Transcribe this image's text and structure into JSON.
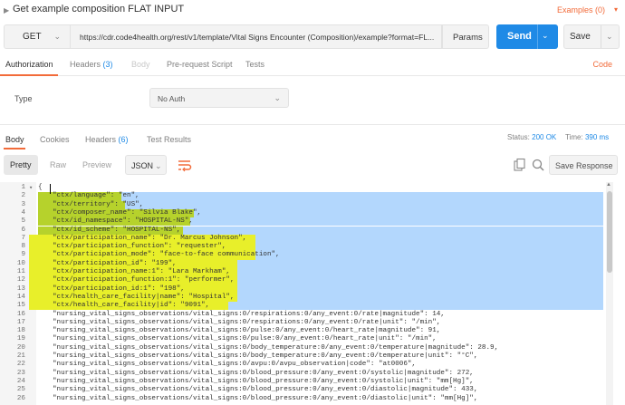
{
  "header": {
    "title": "Get example composition FLAT INPUT",
    "examples_label": "Examples (0)"
  },
  "request": {
    "method": "GET",
    "url": "https://cdr.code4health.org/rest/v1/template/Vital Signs Encounter (Composition)/example?format=FL...",
    "params_label": "Params",
    "send_label": "Send",
    "save_label": "Save"
  },
  "request_tabs": [
    {
      "label": "Authorization",
      "count": ""
    },
    {
      "label": "Headers",
      "count": "(3)"
    },
    {
      "label": "Body",
      "count": ""
    },
    {
      "label": "Pre-request Script",
      "count": ""
    },
    {
      "label": "Tests",
      "count": ""
    }
  ],
  "code_label": "Code",
  "auth": {
    "type_label": "Type",
    "type_value": "No Auth"
  },
  "response_tabs": [
    {
      "label": "Body",
      "count": ""
    },
    {
      "label": "Cookies",
      "count": ""
    },
    {
      "label": "Headers",
      "count": "(6)"
    },
    {
      "label": "Test Results",
      "count": ""
    }
  ],
  "response_meta": {
    "status_label": "Status:",
    "status_value": "200 OK",
    "time_label": "Time:",
    "time_value": "390 ms"
  },
  "view_modes": [
    "Pretty",
    "Raw",
    "Preview"
  ],
  "format_value": "JSON",
  "save_response_label": "Save Response",
  "colors": {
    "accent": "#f26b3a",
    "send_blue": "#1f8ae6",
    "selection": "#b3d7fd",
    "highlight_yellow": "#e8ef2a",
    "highlight_green": "#b6d22c"
  },
  "code_lines": [
    {
      "n": "1",
      "fold": "▾",
      "text": "{"
    },
    {
      "n": "2",
      "fold": "",
      "text": "\"ctx/language\": \"en\","
    },
    {
      "n": "3",
      "fold": "",
      "text": "\"ctx/territory\": \"US\","
    },
    {
      "n": "4",
      "fold": "",
      "text": "\"ctx/composer_name\": \"Silvia Blake\","
    },
    {
      "n": "5",
      "fold": "",
      "text": "\"ctx/id_namespace\": \"HOSPITAL-NS\","
    },
    {
      "n": "6",
      "fold": "",
      "text": "\"ctx/id_scheme\": \"HOSPITAL-NS\","
    },
    {
      "n": "7",
      "fold": "",
      "text": "\"ctx/participation_name\": \"Dr. Marcus Johnson\","
    },
    {
      "n": "8",
      "fold": "",
      "text": "\"ctx/participation_function\": \"requester\","
    },
    {
      "n": "9",
      "fold": "",
      "text": "\"ctx/participation_mode\": \"face-to-face communication\","
    },
    {
      "n": "10",
      "fold": "",
      "text": "\"ctx/participation_id\": \"199\","
    },
    {
      "n": "11",
      "fold": "",
      "text": "\"ctx/participation_name:1\": \"Lara Markham\","
    },
    {
      "n": "12",
      "fold": "",
      "text": "\"ctx/participation_function:1\": \"performer\","
    },
    {
      "n": "13",
      "fold": "",
      "text": "\"ctx/participation_id:1\": \"198\","
    },
    {
      "n": "14",
      "fold": "",
      "text": "\"ctx/health_care_facility|name\": \"Hospital\","
    },
    {
      "n": "15",
      "fold": "",
      "text": "\"ctx/health_care_facility|id\": \"9091\","
    },
    {
      "n": "16",
      "fold": "",
      "text": "\"nursing_vital_signs_observations/vital_signs:0/respirations:0/any_event:0/rate|magnitude\": 14,"
    },
    {
      "n": "17",
      "fold": "",
      "text": "\"nursing_vital_signs_observations/vital_signs:0/respirations:0/any_event:0/rate|unit\": \"/min\","
    },
    {
      "n": "18",
      "fold": "",
      "text": "\"nursing_vital_signs_observations/vital_signs:0/pulse:0/any_event:0/heart_rate|magnitude\": 91,"
    },
    {
      "n": "19",
      "fold": "",
      "text": "\"nursing_vital_signs_observations/vital_signs:0/pulse:0/any_event:0/heart_rate|unit\": \"/min\","
    },
    {
      "n": "20",
      "fold": "",
      "text": "\"nursing_vital_signs_observations/vital_signs:0/body_temperature:0/any_event:0/temperature|magnitude\": 28.9,"
    },
    {
      "n": "21",
      "fold": "",
      "text": "\"nursing_vital_signs_observations/vital_signs:0/body_temperature:0/any_event:0/temperature|unit\": \"°C\","
    },
    {
      "n": "22",
      "fold": "",
      "text": "\"nursing_vital_signs_observations/vital_signs:0/avpu:0/avpu_observation|code\": \"at0006\","
    },
    {
      "n": "23",
      "fold": "",
      "text": "\"nursing_vital_signs_observations/vital_signs:0/blood_pressure:0/any_event:0/systolic|magnitude\": 272,"
    },
    {
      "n": "24",
      "fold": "",
      "text": "\"nursing_vital_signs_observations/vital_signs:0/blood_pressure:0/any_event:0/systolic|unit\": \"mm[Hg]\","
    },
    {
      "n": "25",
      "fold": "",
      "text": "\"nursing_vital_signs_observations/vital_signs:0/blood_pressure:0/any_event:0/diastolic|magnitude\": 433,"
    },
    {
      "n": "26",
      "fold": "",
      "text": "\"nursing_vital_signs_observations/vital_signs:0/blood_pressure:0/any_event:0/diastolic|unit\": \"mm[Hg]\","
    }
  ]
}
